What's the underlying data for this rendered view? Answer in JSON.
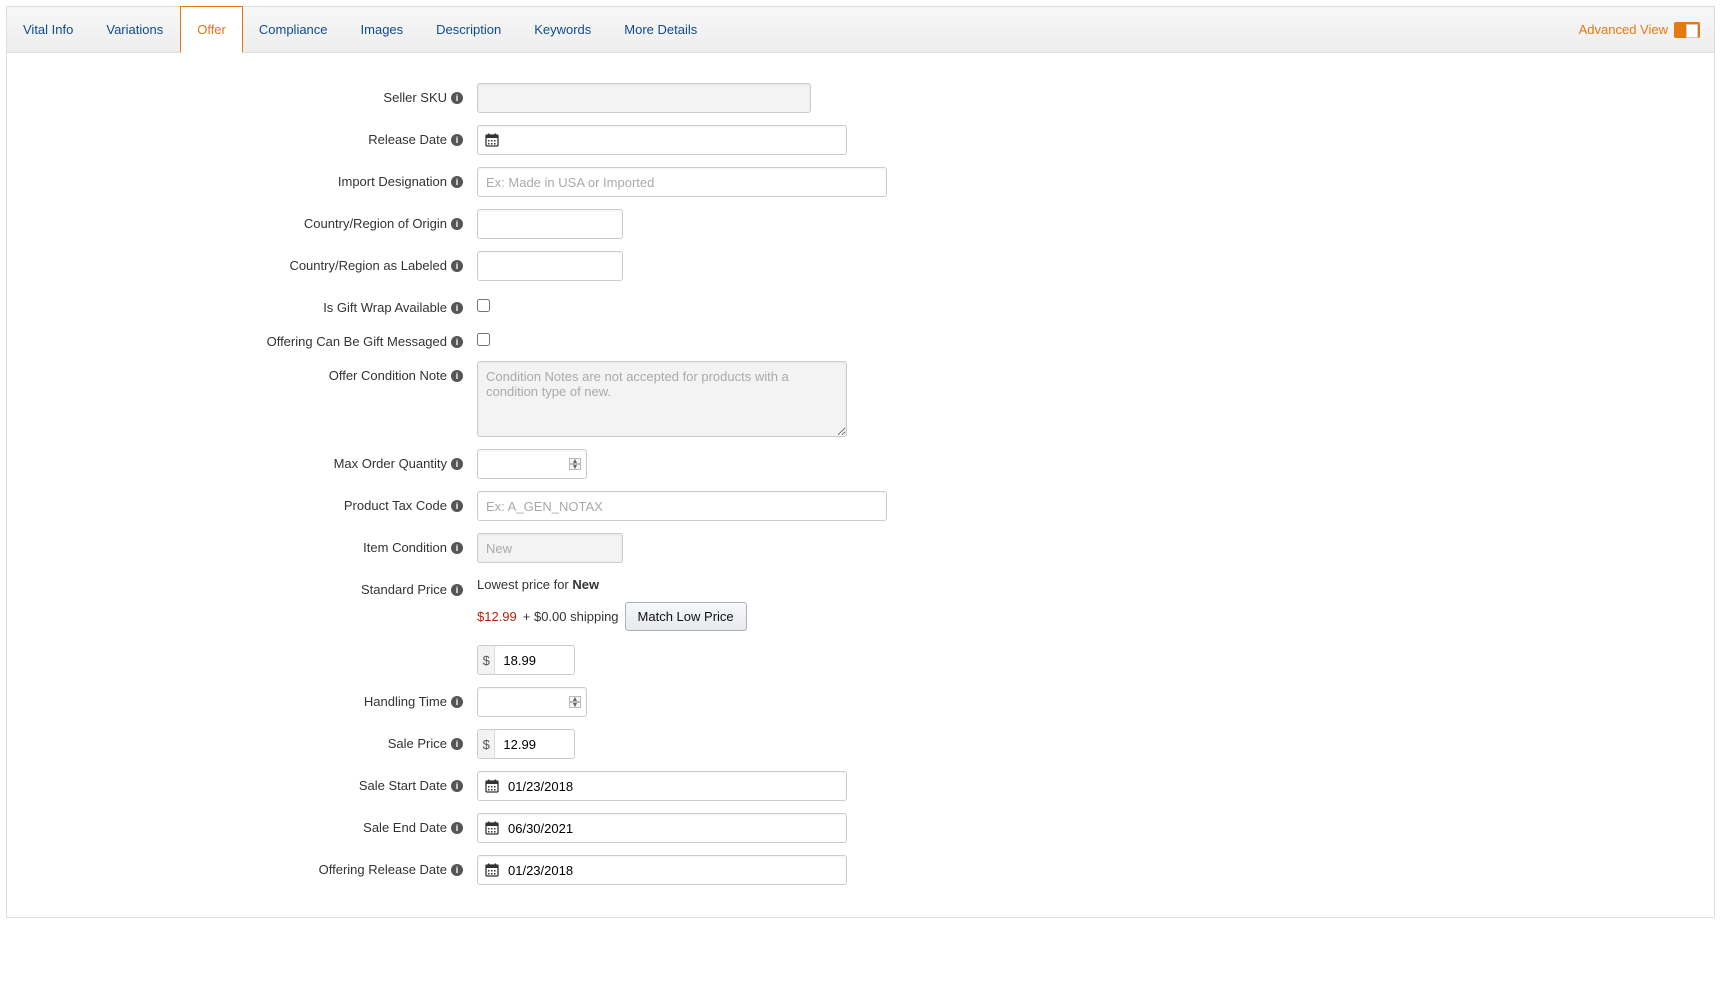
{
  "tabs": [
    {
      "label": "Vital Info",
      "active": false
    },
    {
      "label": "Variations",
      "active": false
    },
    {
      "label": "Offer",
      "active": true
    },
    {
      "label": "Compliance",
      "active": false
    },
    {
      "label": "Images",
      "active": false
    },
    {
      "label": "Description",
      "active": false
    },
    {
      "label": "Keywords",
      "active": false
    },
    {
      "label": "More Details",
      "active": false
    }
  ],
  "advanced_view_label": "Advanced View",
  "fields": {
    "seller_sku": {
      "label": "Seller SKU",
      "value": ""
    },
    "release_date": {
      "label": "Release Date",
      "value": ""
    },
    "import_designation": {
      "label": "Import Designation",
      "placeholder": "Ex: Made in USA or Imported",
      "value": ""
    },
    "country_origin": {
      "label": "Country/Region of Origin",
      "value": ""
    },
    "country_labeled": {
      "label": "Country/Region as Labeled",
      "value": ""
    },
    "gift_wrap": {
      "label": "Is Gift Wrap Available",
      "checked": false
    },
    "gift_messaged": {
      "label": "Offering Can Be Gift Messaged",
      "checked": false
    },
    "condition_note": {
      "label": "Offer Condition Note",
      "placeholder": "Condition Notes are not accepted for products with a condition type of new."
    },
    "max_order_qty": {
      "label": "Max Order Quantity",
      "value": ""
    },
    "tax_code": {
      "label": "Product Tax Code",
      "placeholder": "Ex: A_GEN_NOTAX",
      "value": ""
    },
    "item_condition": {
      "label": "Item Condition",
      "placeholder": "New",
      "value": ""
    },
    "standard_price": {
      "label": "Standard Price",
      "lowest_prefix": "Lowest price for ",
      "lowest_for": "New",
      "low_price": "$12.99",
      "shipping_text": " + $0.00 shipping",
      "match_btn": "Match Low Price",
      "currency": "$",
      "value": "18.99"
    },
    "handling_time": {
      "label": "Handling Time",
      "value": ""
    },
    "sale_price": {
      "label": "Sale Price",
      "currency": "$",
      "value": "12.99"
    },
    "sale_start": {
      "label": "Sale Start Date",
      "value": "01/23/2018"
    },
    "sale_end": {
      "label": "Sale End Date",
      "value": "06/30/2021"
    },
    "offering_release": {
      "label": "Offering Release Date",
      "value": "01/23/2018"
    }
  }
}
